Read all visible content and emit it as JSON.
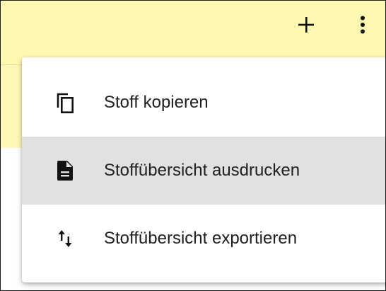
{
  "toolbar": {
    "add_icon": "plus-icon",
    "more_icon": "more-vert-icon"
  },
  "menu": {
    "items": [
      {
        "label": "Stoff kopieren",
        "icon": "copy-icon",
        "highlighted": false
      },
      {
        "label": "Stoffübersicht ausdrucken",
        "icon": "document-icon",
        "highlighted": true
      },
      {
        "label": "Stoffübersicht exportieren",
        "icon": "import-export-icon",
        "highlighted": false
      }
    ]
  },
  "colors": {
    "app_bar": "#fff8b0",
    "menu_background": "#ffffff",
    "highlight": "#e1e1e1",
    "text": "#212121"
  }
}
